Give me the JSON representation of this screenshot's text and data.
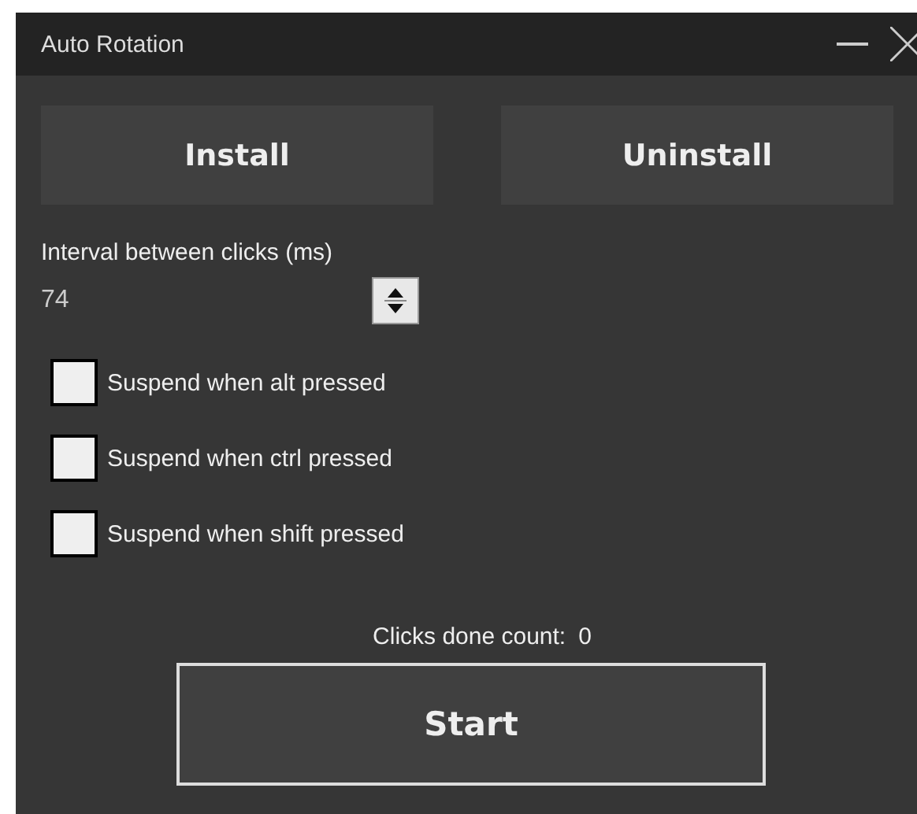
{
  "window": {
    "title": "Auto Rotation"
  },
  "buttons": [
    {
      "label": "Install"
    },
    {
      "label": "Uninstall"
    }
  ],
  "interval": {
    "label": "Interval between clicks (ms)",
    "value": "74"
  },
  "options": [
    {
      "label": "Suspend when alt pressed",
      "checked": false
    },
    {
      "label": "Suspend when ctrl pressed",
      "checked": false
    },
    {
      "label": "Suspend when shift pressed",
      "checked": false
    }
  ],
  "counter": {
    "label": "Clicks done count:",
    "value": "0"
  },
  "start_button": {
    "label": "Start"
  }
}
